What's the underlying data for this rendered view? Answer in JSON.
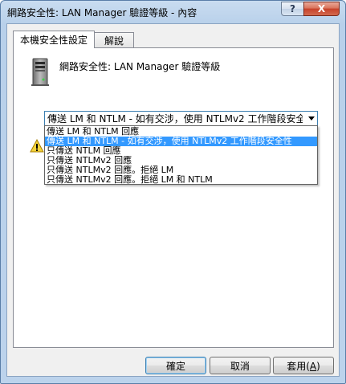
{
  "window": {
    "title": "網路安全性: LAN Manager 驗證等級 - 內容",
    "help_label": "?",
    "close_label": "X"
  },
  "tabs": [
    {
      "label": "本機安全性設定",
      "active": true
    },
    {
      "label": "解說",
      "active": false
    }
  ],
  "policy": {
    "heading": "網路安全性: LAN Manager 驗證等級",
    "icon": "server-icon",
    "warning_icon": "warning-icon"
  },
  "combo": {
    "selected_text": "傳送 LM 和 NTLM - 如有交涉，使用 NTLMv2 工作階段安全性",
    "options": [
      "傳送 LM 和 NTLM 回應",
      "傳送 LM 和 NTLM - 如有交涉，使用 NTLMv2 工作階段安全性",
      "只傳送 NTLM 回應",
      "只傳送 NTLMv2 回應",
      "只傳送 NTLMv2 回應。拒絕 LM",
      "只傳送 NTLMv2 回應。拒絕 LM 和 NTLM"
    ],
    "selected_index": 1
  },
  "buttons": {
    "ok": "確定",
    "cancel": "取消",
    "apply_prefix": "套用(",
    "apply_key": "A",
    "apply_suffix": ")"
  },
  "colors": {
    "selection": "#3399ff",
    "frame": "#b8d0ea"
  }
}
